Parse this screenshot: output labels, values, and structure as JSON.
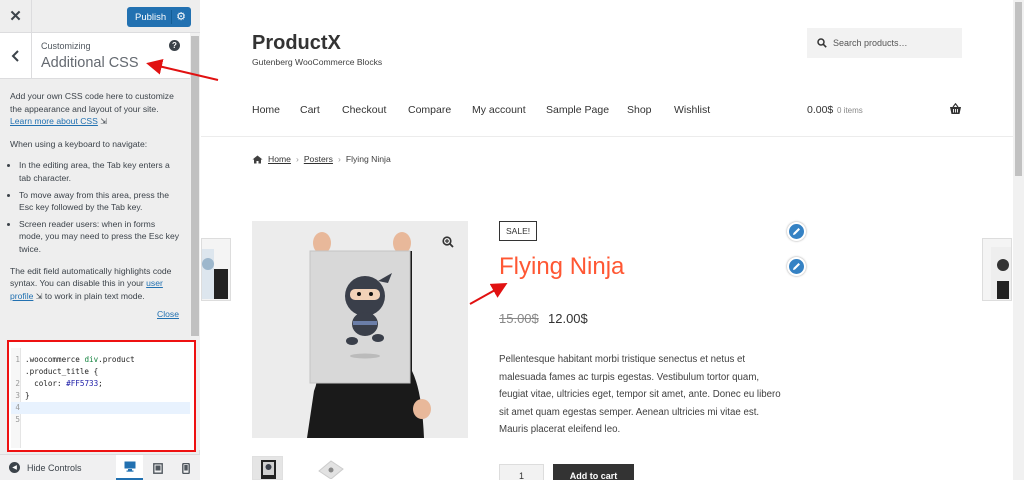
{
  "customizer": {
    "close_glyph": "✕",
    "publish_label": "Publish",
    "subtitle": "Customizing",
    "title": "Additional CSS",
    "help_glyph": "?",
    "intro": "Add your own CSS code here to customize the appearance and layout of your site.",
    "learn_more": "Learn more about CSS",
    "keyboard_intro": "When using a keyboard to navigate:",
    "tips": [
      "In the editing area, the Tab key enters a tab character.",
      "To move away from this area, press the Esc key followed by the Tab key.",
      "Screen reader users: when in forms mode, you may need to press the Esc key twice."
    ],
    "highlight_text": "The edit field automatically highlights code syntax. You can disable this in your",
    "user_profile_link": "user profile",
    "highlight_text_end": "to work in plain text mode.",
    "close_link": "Close",
    "code_lines": [
      {
        "num": "1",
        "sel": ".woocommerce ",
        "tag": "div",
        "rest": ".product"
      },
      {
        "num": "",
        "text": ".product_title {"
      },
      {
        "num": "2",
        "prop": "  color: ",
        "value": "#FF5733",
        "end": ";"
      },
      {
        "num": "3",
        "text": "}"
      },
      {
        "num": "4",
        "text": ""
      },
      {
        "num": "5",
        "text": ""
      }
    ],
    "hide_controls": "Hide Controls",
    "devices": [
      "desktop",
      "tablet",
      "mobile"
    ]
  },
  "site": {
    "name": "ProductX",
    "tagline": "Gutenberg WooCommerce Blocks",
    "search_placeholder": "Search products…",
    "nav": [
      "Home",
      "Cart",
      "Checkout",
      "Compare",
      "My account",
      "Sample Page",
      "Shop",
      "Wishlist"
    ],
    "cart_total": "0.00$",
    "cart_items": "0 items",
    "breadcrumb": {
      "home": "Home",
      "category": "Posters",
      "current": "Flying Ninja"
    }
  },
  "product": {
    "sale_badge": "SALE!",
    "title": "Flying Ninja",
    "title_color": "#FF5733",
    "old_price": "15.00$",
    "new_price": "12.00$",
    "description": "Pellentesque habitant morbi tristique senectus et netus et malesuada fames ac turpis egestas. Vestibulum tortor quam, feugiat vitae, ultricies eget, tempor sit amet, ante. Donec eu libero sit amet quam egestas semper. Aenean ultricies mi vitae est. Mauris placerat eleifend leo.",
    "quantity": "1",
    "add_to_cart": "Add to cart"
  },
  "colors": {
    "accent": "#2271b1",
    "annotation": "#e11111"
  }
}
